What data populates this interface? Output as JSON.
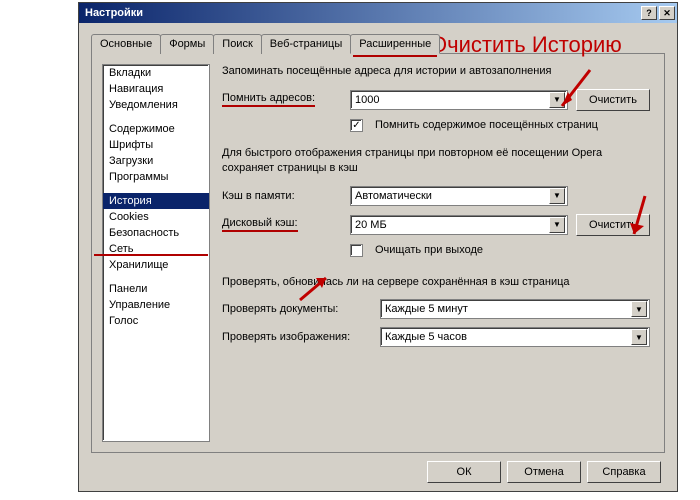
{
  "window": {
    "title": "Настройки"
  },
  "tabs": {
    "items": [
      "Основные",
      "Формы",
      "Поиск",
      "Веб-страницы",
      "Расширенные"
    ],
    "active": "Расширенные"
  },
  "sidebar": {
    "groups": [
      [
        "Вкладки",
        "Навигация",
        "Уведомления"
      ],
      [
        "Содержимое",
        "Шрифты",
        "Загрузки",
        "Программы"
      ],
      [
        "История",
        "Cookies",
        "Безопасность",
        "Сеть",
        "Хранилище"
      ],
      [
        "Панели",
        "Управление",
        "Голос"
      ]
    ],
    "selected": "История"
  },
  "content": {
    "history_heading": "Запоминать посещённые адреса для истории и автозаполнения",
    "remember_label": "Помнить адресов:",
    "remember_value": "1000",
    "clear_btn": "Очистить",
    "remember_content_chk": {
      "checked": true,
      "label": "Помнить содержимое посещённых страниц"
    },
    "cache_desc": "Для быстрого отображения страницы при повторном её посещении Opera сохраняет страницы в кэш",
    "mem_cache_label": "Кэш в памяти:",
    "mem_cache_value": "Автоматически",
    "disk_cache_label": "Дисковый кэш:",
    "disk_cache_value": "20 МБ",
    "clear_on_exit_chk": {
      "checked": false,
      "label": "Очищать при выходе"
    },
    "check_heading": "Проверять, обновилась ли на сервере сохранённая в кэш страница",
    "check_docs_label": "Проверять документы:",
    "check_docs_value": "Каждые 5 минут",
    "check_images_label": "Проверять изображения:",
    "check_images_value": "Каждые 5 часов"
  },
  "footer": {
    "ok": "ОК",
    "cancel": "Отмена",
    "help": "Справка"
  },
  "annotation": {
    "text": "Очистить Историю"
  }
}
